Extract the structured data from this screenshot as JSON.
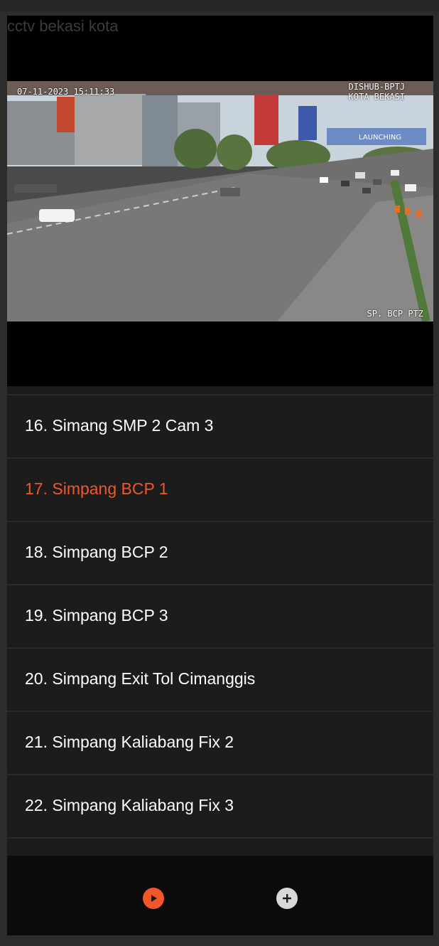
{
  "page": {
    "title": "cctv bekasi kota"
  },
  "video": {
    "timestamp": "07-11-2023 15:11:33",
    "agency_line1": "DISHUB-BPTJ",
    "agency_line2": "KOTA BEKASI",
    "camera_label": "SP. BCP PTZ",
    "billboard_text": "LAUNCHING"
  },
  "list": {
    "active_color": "#f0582a",
    "items": [
      {
        "label": "16. Simang SMP 2 Cam 3",
        "active": false
      },
      {
        "label": "17. Simpang BCP 1",
        "active": true
      },
      {
        "label": "18. Simpang BCP 2",
        "active": false
      },
      {
        "label": "19. Simpang BCP 3",
        "active": false
      },
      {
        "label": "20. Simpang Exit Tol Cimanggis",
        "active": false
      },
      {
        "label": "21. Simpang Kaliabang Fix 2",
        "active": false
      },
      {
        "label": "22. Simpang Kaliabang Fix 3",
        "active": false
      }
    ]
  },
  "controls": {
    "play_icon": "play-icon",
    "add_icon": "plus-icon",
    "play_color": "#f0582a"
  }
}
